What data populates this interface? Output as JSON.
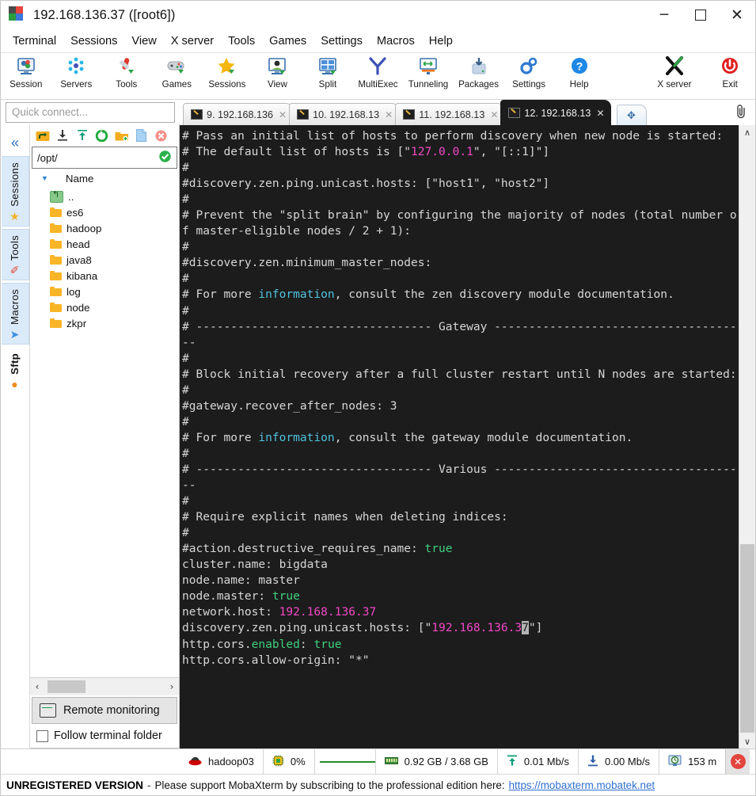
{
  "window": {
    "title": "192.168.136.37 ([root6])",
    "minimize_label": "─",
    "maximize_label": "",
    "close_label": "✕"
  },
  "menubar": {
    "items": [
      "Terminal",
      "Sessions",
      "View",
      "X server",
      "Tools",
      "Games",
      "Settings",
      "Macros",
      "Help"
    ]
  },
  "toolbar": {
    "buttons": [
      {
        "label": "Session",
        "icon": "session-icon"
      },
      {
        "label": "Servers",
        "icon": "servers-icon"
      },
      {
        "label": "Tools",
        "icon": "tools-icon"
      },
      {
        "label": "Games",
        "icon": "games-icon"
      },
      {
        "label": "Sessions",
        "icon": "sessions-star-icon"
      },
      {
        "label": "View",
        "icon": "view-icon"
      },
      {
        "label": "Split",
        "icon": "split-icon"
      },
      {
        "label": "MultiExec",
        "icon": "multiexec-icon"
      },
      {
        "label": "Tunneling",
        "icon": "tunneling-icon"
      },
      {
        "label": "Packages",
        "icon": "packages-icon"
      },
      {
        "label": "Settings",
        "icon": "settings-gear-icon"
      },
      {
        "label": "Help",
        "icon": "help-icon"
      }
    ],
    "right_buttons": [
      {
        "label": "X server",
        "icon": "xserver-icon"
      },
      {
        "label": "Exit",
        "icon": "exit-power-icon"
      }
    ]
  },
  "sidebar": {
    "quick_connect_placeholder": "Quick connect...",
    "collapse_icon": "«",
    "vtabs": [
      {
        "label": "Sessions",
        "icon": "★",
        "icon_color": "#f4b223",
        "active": false
      },
      {
        "label": "Tools",
        "icon": "✐",
        "icon_color": "#e24a3a",
        "active": false
      },
      {
        "label": "Macros",
        "icon": "➤",
        "icon_color": "#3c8fe0",
        "active": false
      },
      {
        "label": "Sftp",
        "icon": "●",
        "icon_color": "#f08a1c",
        "active": true
      }
    ],
    "sftp_tools": [
      {
        "name": "go-up-icon",
        "glyph": "↰",
        "color": "#e8a523"
      },
      {
        "name": "download-icon",
        "glyph": "⬇",
        "color": "#3a3a3a"
      },
      {
        "name": "upload-icon",
        "glyph": "⬆",
        "color": "#1b9c7a"
      },
      {
        "name": "refresh-icon",
        "glyph": "⟳",
        "color": "#1faa3a"
      },
      {
        "name": "new-folder-icon",
        "glyph": "▮",
        "color": "#f0a818"
      },
      {
        "name": "new-file-icon",
        "glyph": "▯",
        "color": "#9dcdf2"
      },
      {
        "name": "delete-icon",
        "glyph": "✕",
        "color": "#f08a8a"
      }
    ],
    "path": "/opt/",
    "path_ok_icon": "✓",
    "column_header": "Name",
    "files": [
      {
        "name": "..",
        "type": "parent"
      },
      {
        "name": "es6",
        "type": "folder"
      },
      {
        "name": "hadoop",
        "type": "folder"
      },
      {
        "name": "head",
        "type": "folder"
      },
      {
        "name": "java8",
        "type": "folder"
      },
      {
        "name": "kibana",
        "type": "folder"
      },
      {
        "name": "log",
        "type": "folder"
      },
      {
        "name": "node",
        "type": "folder"
      },
      {
        "name": "zkpr",
        "type": "folder"
      }
    ],
    "hscroll_left": "‹",
    "hscroll_right": "›",
    "remote_monitoring_label": "Remote monitoring",
    "follow_terminal_folder_label": "Follow terminal folder"
  },
  "tabs": {
    "items": [
      {
        "label": "9. 192.168.136",
        "close": "✕",
        "active": false
      },
      {
        "label": "10. 192.168.13",
        "close": "✕",
        "active": false
      },
      {
        "label": "11. 192.168.13",
        "close": "✕",
        "active": false
      },
      {
        "label": "12. 192.168.13",
        "close": "✕",
        "active": true
      }
    ],
    "new_tab_icon": "✥",
    "clip_icon": "📎"
  },
  "terminal": {
    "lines": [
      [
        {
          "t": "# Pass an initial list of hosts to perform discovery when new node is started:",
          "c": "n"
        }
      ],
      [
        {
          "t": "# The default list of hosts is [\"",
          "c": "n"
        },
        {
          "t": "127.0.0.1",
          "c": "m"
        },
        {
          "t": "\", \"[::1]\"]",
          "c": "n"
        }
      ],
      [
        {
          "t": "#",
          "c": "n"
        }
      ],
      [
        {
          "t": "#discovery.zen.ping.unicast.hosts: [\"host1\", \"host2\"]",
          "c": "n"
        }
      ],
      [
        {
          "t": "#",
          "c": "n"
        }
      ],
      [
        {
          "t": "# Prevent the \"split brain\" by configuring the majority of nodes (total number of master-eligible nodes / 2 + 1):",
          "c": "n"
        }
      ],
      [
        {
          "t": "#",
          "c": "n"
        }
      ],
      [
        {
          "t": "#discovery.zen.minimum_master_nodes:",
          "c": "n"
        }
      ],
      [
        {
          "t": "#",
          "c": "n"
        }
      ],
      [
        {
          "t": "# For more ",
          "c": "n"
        },
        {
          "t": "information",
          "c": "c"
        },
        {
          "t": ", consult the zen discovery module documentation.",
          "c": "n"
        }
      ],
      [
        {
          "t": "#",
          "c": "n"
        }
      ],
      [
        {
          "t": "# ---------------------------------- Gateway -------------------------------------",
          "c": "n"
        }
      ],
      [
        {
          "t": "#",
          "c": "n"
        }
      ],
      [
        {
          "t": "# Block initial recovery after a full cluster restart until N nodes are started:",
          "c": "n"
        }
      ],
      [
        {
          "t": "#",
          "c": "n"
        }
      ],
      [
        {
          "t": "#gateway.recover_after_nodes: 3",
          "c": "n"
        }
      ],
      [
        {
          "t": "#",
          "c": "n"
        }
      ],
      [
        {
          "t": "# For more ",
          "c": "n"
        },
        {
          "t": "information",
          "c": "c"
        },
        {
          "t": ", consult the gateway module documentation.",
          "c": "n"
        }
      ],
      [
        {
          "t": "#",
          "c": "n"
        }
      ],
      [
        {
          "t": "# ---------------------------------- Various -------------------------------------",
          "c": "n"
        }
      ],
      [
        {
          "t": "#",
          "c": "n"
        }
      ],
      [
        {
          "t": "# Require explicit names when deleting indices:",
          "c": "n"
        }
      ],
      [
        {
          "t": "#",
          "c": "n"
        }
      ],
      [
        {
          "t": "#action.destructive_requires_name: ",
          "c": "n"
        },
        {
          "t": "true",
          "c": "g"
        }
      ],
      [
        {
          "t": "cluster.name: bigdata",
          "c": "n"
        }
      ],
      [
        {
          "t": "node.name: master",
          "c": "n"
        }
      ],
      [
        {
          "t": "node.master: ",
          "c": "n"
        },
        {
          "t": "true",
          "c": "g"
        }
      ],
      [
        {
          "t": "network.host: ",
          "c": "n"
        },
        {
          "t": "192.168.136.37",
          "c": "m"
        }
      ],
      [
        {
          "t": "discovery.zen.ping.unicast.hosts: [\"",
          "c": "n"
        },
        {
          "t": "192.168.136.3",
          "c": "m"
        },
        {
          "t": "7",
          "c": "cur"
        },
        {
          "t": "\"]",
          "c": "n"
        }
      ],
      [
        {
          "t": "http.cors.",
          "c": "n"
        },
        {
          "t": "enabled",
          "c": "g"
        },
        {
          "t": ": ",
          "c": "n"
        },
        {
          "t": "true",
          "c": "g"
        }
      ],
      [
        {
          "t": "http.cors.allow-origin: \"*\"",
          "c": "n"
        }
      ]
    ],
    "scroll_up_icon": "∧",
    "scroll_down_icon": "∨"
  },
  "statusbar": {
    "cells": [
      {
        "icon": "redhat-icon",
        "label": "hadoop03"
      },
      {
        "icon": "cpu-icon",
        "label": "0%"
      },
      {
        "icon": "graph",
        "label": ""
      },
      {
        "icon": "memory-icon",
        "label": "0.92 GB / 3.68 GB"
      },
      {
        "icon": "upload-arrow-icon",
        "label": "0.01 Mb/s"
      },
      {
        "icon": "download-arrow-icon",
        "label": "0.00 Mb/s"
      },
      {
        "icon": "clock-monitor-icon",
        "label": "153 m"
      }
    ],
    "close_icon": "✕"
  },
  "footer": {
    "unregistered": "UNREGISTERED VERSION",
    "separator": "-",
    "message": "Please support MobaXterm by subscribing to the professional edition here:",
    "link": "https://mobaxterm.mobatek.net"
  },
  "colors": {
    "terminal_bg": "#1c1c1c",
    "terminal_fg": "#d6d6d6",
    "magenta": "#f048c6",
    "green": "#3fd07f",
    "cyan": "#4fc3dd",
    "accent_blue": "#2a6fc9"
  }
}
